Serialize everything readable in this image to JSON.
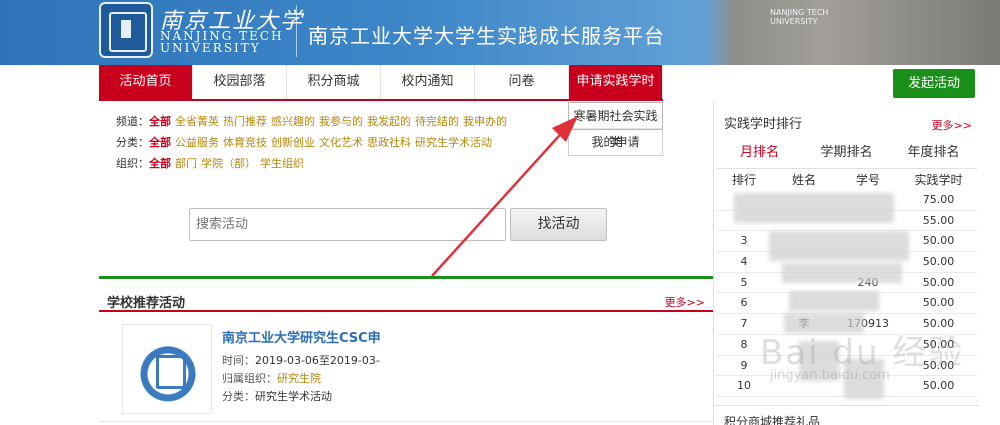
{
  "header": {
    "logo_cn": "南京工业大学",
    "logo_en_line1": "NANJING TECH",
    "logo_en_line2": "UNIVERSITY",
    "platform_title": "南京工业大学大学生实践成长服务平台",
    "photo_caption_line1": "NANJING TECH",
    "photo_caption_line2": "UNIVERSITY"
  },
  "nav": {
    "items": [
      {
        "label": "活动首页"
      },
      {
        "label": "校园部落"
      },
      {
        "label": "积分商城"
      },
      {
        "label": "校内通知"
      },
      {
        "label": "问卷"
      },
      {
        "label": "申请实践学时"
      }
    ],
    "launch_label": "发起活动"
  },
  "dropdown": {
    "items": [
      "寒暑期社会实践类",
      "我的申请"
    ]
  },
  "filters": {
    "channel": {
      "label": "频道：",
      "all": "全部",
      "options": [
        "全省菁英",
        "热门推荐",
        "感兴趣的",
        "我参与的",
        "我发起的",
        "待完结的",
        "我申办的"
      ]
    },
    "category": {
      "label": "分类：",
      "all": "全部",
      "options": [
        "公益服务",
        "体育竞技",
        "创新创业",
        "文化艺术",
        "思政社科",
        "研究生学术活动"
      ]
    },
    "org": {
      "label": "组织：",
      "all": "全部",
      "options": [
        "部门",
        "学院（部）",
        "学生组织"
      ]
    }
  },
  "search": {
    "placeholder": "搜索活动",
    "button_label": "找活动"
  },
  "recommended": {
    "title": "学校推荐活动",
    "more": "更多>>",
    "card": {
      "title": "南京工业大学研究生CSC申",
      "time_label": "时间：",
      "time_value": "2019-03-06至2019-03-",
      "org_label": "归属组织：",
      "org_value": "研究生院",
      "cat_label": "分类：",
      "cat_value": "研究生学术活动"
    }
  },
  "ranking": {
    "title": "实践学时排行",
    "more": "更多>>",
    "tabs": [
      "月排名",
      "学期排名",
      "年度排名"
    ],
    "columns": [
      "排行",
      "姓名",
      "学号",
      "实践学时"
    ],
    "rows": [
      {
        "rank": "",
        "name": "",
        "id": "",
        "hours": "75.00"
      },
      {
        "rank": "",
        "name": "",
        "id": "",
        "hours": "55.00"
      },
      {
        "rank": "3",
        "name": "",
        "id": "",
        "hours": "50.00"
      },
      {
        "rank": "4",
        "name": "",
        "id": "",
        "hours": "50.00"
      },
      {
        "rank": "5",
        "name": "",
        "id": "240",
        "hours": "50.00"
      },
      {
        "rank": "6",
        "name": "",
        "id": "",
        "hours": "50.00"
      },
      {
        "rank": "7",
        "name": "李",
        "id": "170913",
        "hours": "50.00"
      },
      {
        "rank": "8",
        "name": "",
        "id": "",
        "hours": "50.00"
      },
      {
        "rank": "9",
        "name": "",
        "id": "",
        "hours": "50.00"
      },
      {
        "rank": "10",
        "name": "",
        "id": "",
        "hours": "50.00"
      }
    ],
    "next_section": "积分商城推荐礼品"
  },
  "watermark": {
    "main": "Bai du 经验",
    "sub": "jingyan.baidu.com"
  },
  "colors": {
    "brand_red": "#c8001e",
    "green": "#1a8f1a",
    "link_gold": "#b8860b",
    "header_blue": "#2f74b8"
  }
}
